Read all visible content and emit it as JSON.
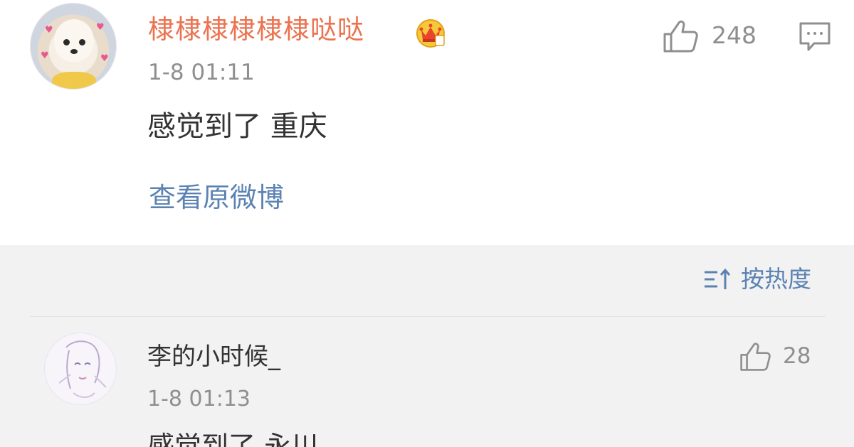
{
  "main_post": {
    "username": "棣棣棣棣棣棣哒哒",
    "timestamp": "1-8 01:11",
    "like_count": "248",
    "content": "感觉到了 重庆",
    "view_original_label": "查看原微博"
  },
  "sort": {
    "label": "按热度"
  },
  "comments": [
    {
      "username": "李的小时候_",
      "timestamp": "1-8 01:13",
      "like_count": "28",
      "content": "感觉到了 永川"
    }
  ],
  "colors": {
    "username_accent": "#eb7350",
    "link_blue": "#5b82b2",
    "meta_gray": "#8f8f8f",
    "text_dark": "#333333",
    "section_bg": "#f2f2f2"
  },
  "icons": [
    "vip-crown-icon",
    "thumbs-up-icon",
    "comment-icon",
    "sort-icon"
  ]
}
